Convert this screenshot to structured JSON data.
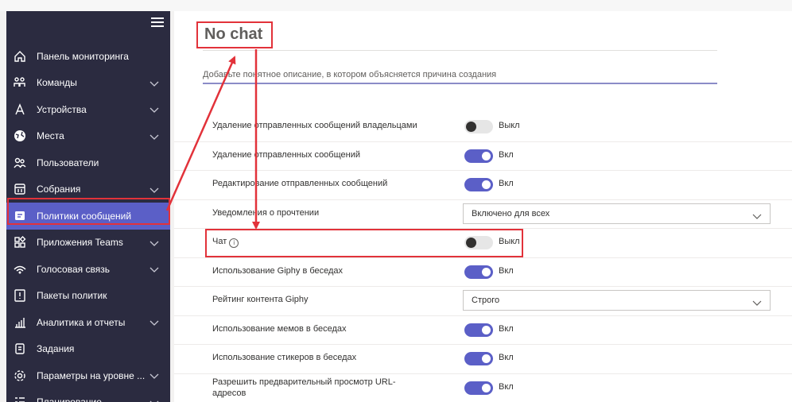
{
  "sidebar": {
    "items": [
      {
        "label": "Панель мониторинга",
        "icon": "home-icon",
        "chevron": false,
        "active": false
      },
      {
        "label": "Команды",
        "icon": "teams-icon",
        "chevron": true,
        "active": false
      },
      {
        "label": "Устройства",
        "icon": "devices-icon",
        "chevron": true,
        "active": false
      },
      {
        "label": "Места",
        "icon": "globe-icon",
        "chevron": true,
        "active": false
      },
      {
        "label": "Пользователи",
        "icon": "users-icon",
        "chevron": false,
        "active": false
      },
      {
        "label": "Собрания",
        "icon": "calendar-icon",
        "chevron": true,
        "active": false
      },
      {
        "label": "Политики сообщений",
        "icon": "message-icon",
        "chevron": false,
        "active": true
      },
      {
        "label": "Приложения Teams",
        "icon": "apps-icon",
        "chevron": true,
        "active": false
      },
      {
        "label": "Голосовая связь",
        "icon": "voice-icon",
        "chevron": true,
        "active": false
      },
      {
        "label": "Пакеты политик",
        "icon": "policy-package-icon",
        "chevron": false,
        "active": false
      },
      {
        "label": "Аналитика и отчеты",
        "icon": "analytics-icon",
        "chevron": true,
        "active": false
      },
      {
        "label": "Задания",
        "icon": "tasks-icon",
        "chevron": false,
        "active": false
      },
      {
        "label": "Параметры на уровне ...",
        "icon": "settings-icon",
        "chevron": true,
        "active": false
      },
      {
        "label": "Планирование",
        "icon": "planning-icon",
        "chevron": true,
        "active": false
      }
    ]
  },
  "policy": {
    "title": "No chat",
    "description_placeholder": "Добавьте понятное описание, в котором объясняется причина создания"
  },
  "settings": [
    {
      "label": "Удаление отправленных сообщений владельцами",
      "type": "toggle",
      "on": false,
      "state": "Выкл"
    },
    {
      "label": "Удаление отправленных сообщений",
      "type": "toggle",
      "on": true,
      "state": "Вкл"
    },
    {
      "label": "Редактирование отправленных сообщений",
      "type": "toggle",
      "on": true,
      "state": "Вкл"
    },
    {
      "label": "Уведомления о прочтении",
      "type": "select",
      "value": "Включено для всех"
    },
    {
      "label": "Чат",
      "type": "toggle",
      "on": false,
      "state": "Выкл",
      "info": true
    },
    {
      "label": "Использование Giphy в беседах",
      "type": "toggle",
      "on": true,
      "state": "Вкл"
    },
    {
      "label": "Рейтинг контента Giphy",
      "type": "select",
      "value": "Строго"
    },
    {
      "label": "Использование мемов в беседах",
      "type": "toggle",
      "on": true,
      "state": "Вкл"
    },
    {
      "label": "Использование стикеров в беседах",
      "type": "toggle",
      "on": true,
      "state": "Вкл"
    },
    {
      "label": "Разрешить предварительный просмотр URL-адресов",
      "type": "toggle",
      "on": true,
      "state": "Вкл"
    }
  ],
  "colors": {
    "accent": "#5b5fc7",
    "sidebar_bg": "#2b2b40",
    "annotation": "#e2323a"
  }
}
